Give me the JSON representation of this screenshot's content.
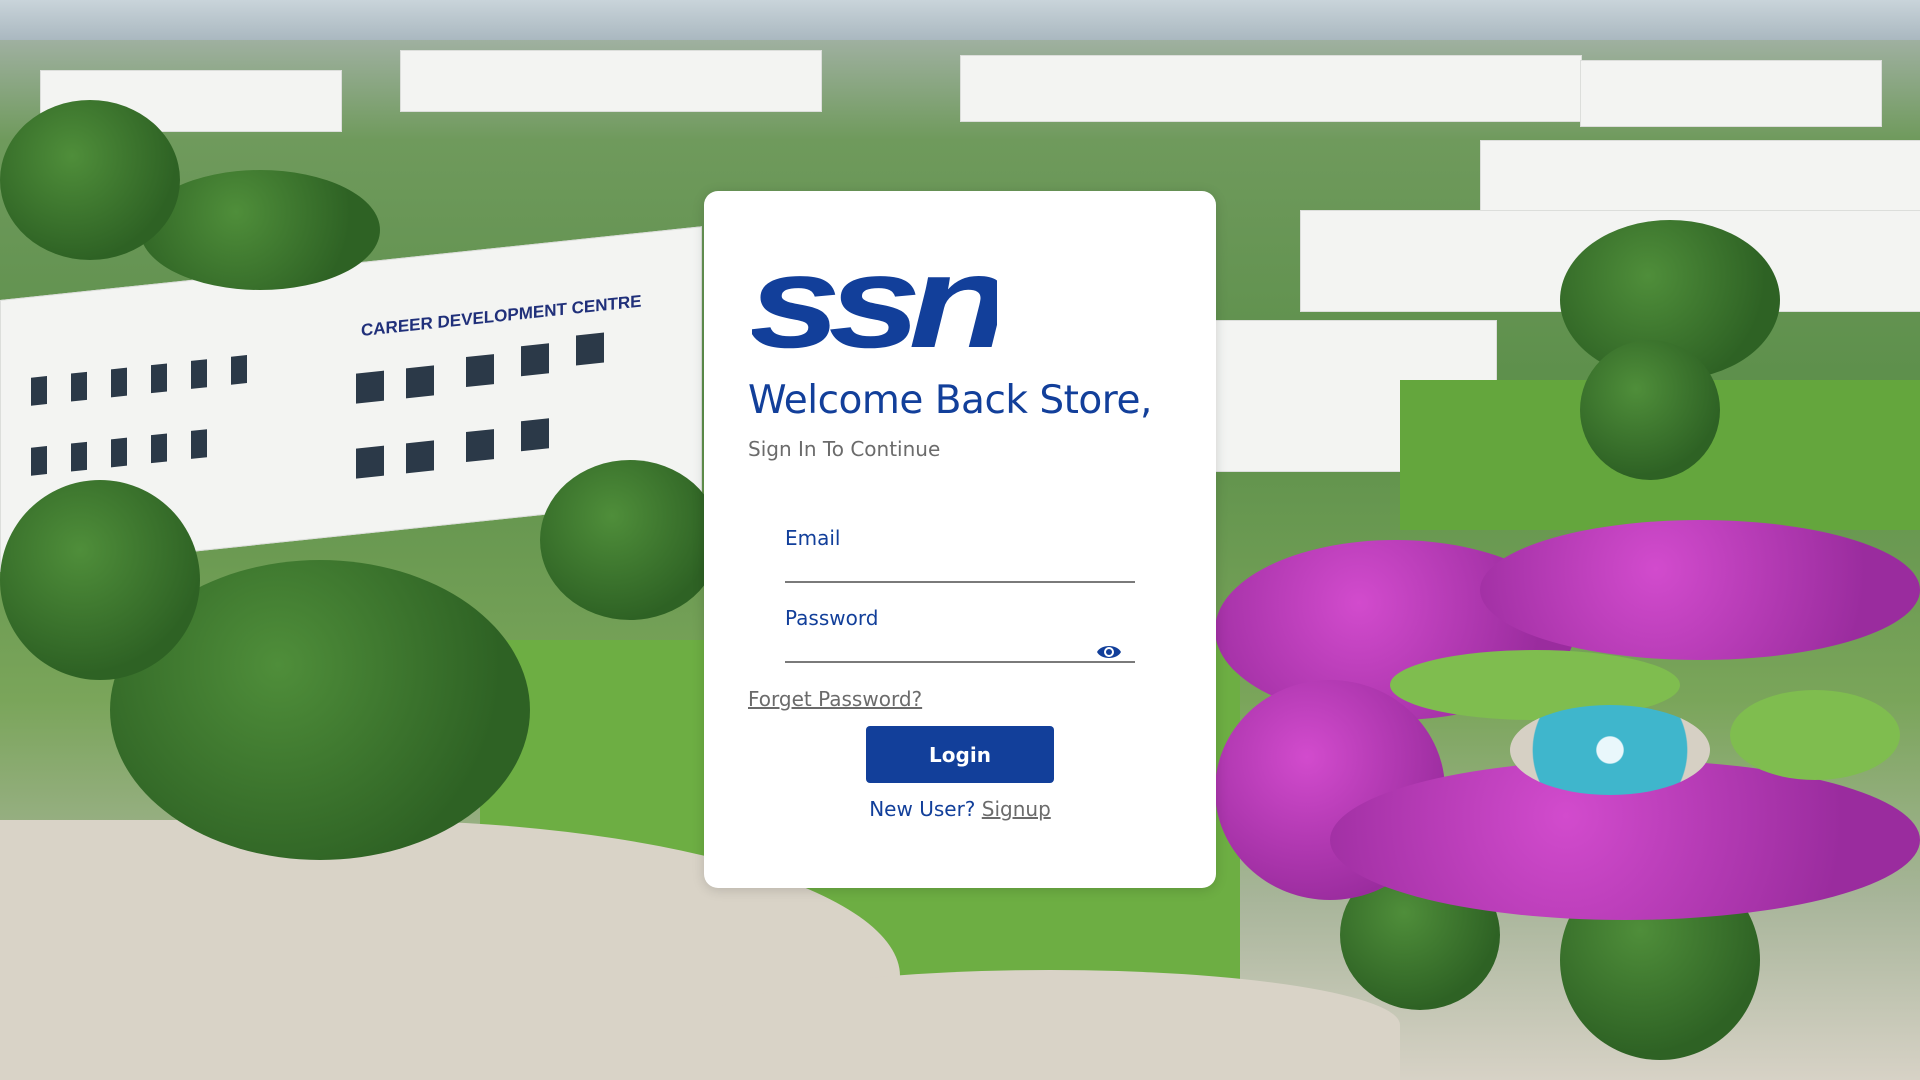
{
  "logo": {
    "text": "ssn",
    "color": "#123f9a"
  },
  "login": {
    "welcome": "Welcome Back Store,",
    "subtitle": "Sign In To Continue",
    "email_label": "Email",
    "email_value": "",
    "password_label": "Password",
    "password_value": "",
    "password_toggle_icon": "eye-icon",
    "forgot_password": "Forget Password?",
    "login_button": "Login",
    "new_user_prefix": "New User?",
    "signup_link": "Signup"
  },
  "background": {
    "sign_text": "CAREER DEVELOPMENT CENTRE"
  },
  "colors": {
    "primary": "#123f9a",
    "muted": "#6b6b6b",
    "card": "#ffffff"
  }
}
